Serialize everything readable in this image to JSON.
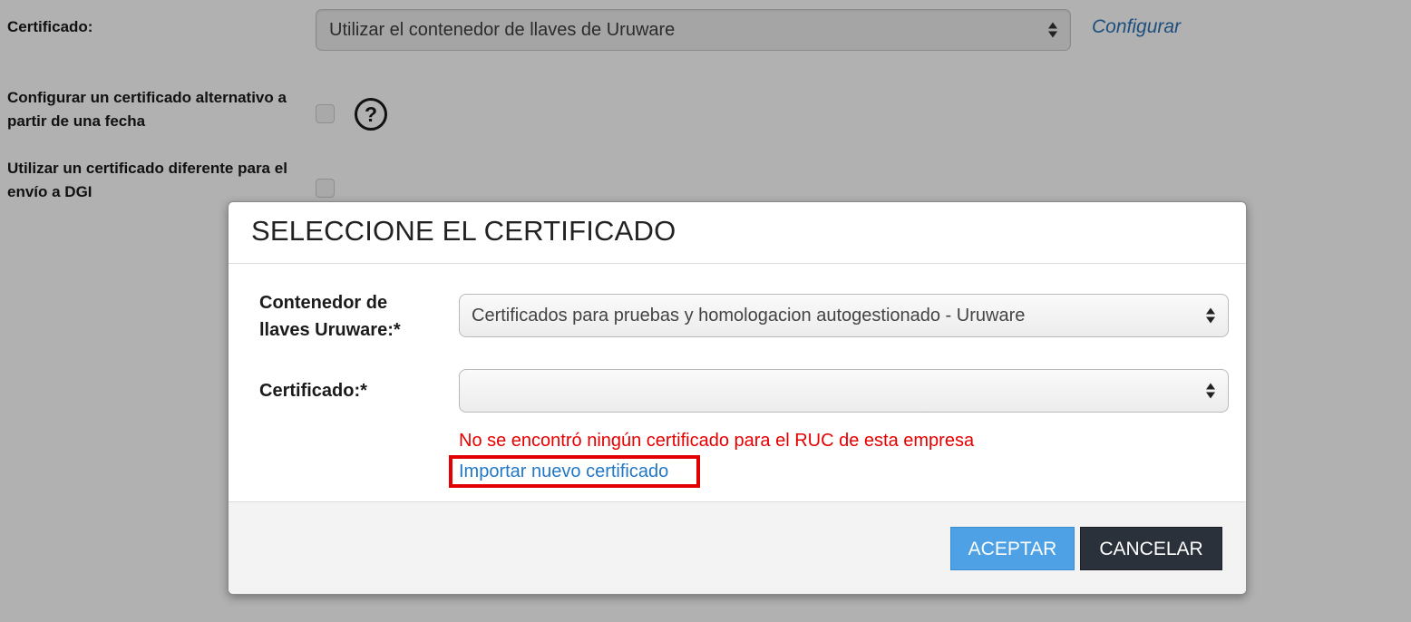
{
  "background": {
    "certificate_label": "Certificado:",
    "certificate_select_value": "Utilizar el contenedor de llaves de Uruware",
    "configure_link": "Configurar",
    "alt_cert_label_line1": "Configurar un certificado alternativo  a",
    "alt_cert_label_line2": "partir de una fecha",
    "help_icon_glyph": "?",
    "diff_cert_label_line1": "Utilizar un certificado diferente para el",
    "diff_cert_label_line2": "envío a DGI"
  },
  "modal": {
    "title": "SELECCIONE EL CERTIFICADO",
    "container_label_line1": "Contenedor de",
    "container_label_line2": "llaves Uruware:*",
    "container_select_value": "Certificados para pruebas y homologacion autogestionado - Uruware",
    "certificate_label": "Certificado:*",
    "certificate_select_value": "",
    "error_message": "No se encontró ningún certificado para el RUC de esta empresa",
    "import_link": "Importar nuevo certificado",
    "accept_button": "ACEPTAR",
    "cancel_button": "CANCELAR"
  },
  "colors": {
    "overlay_background": "#b1b1b1",
    "error_text": "#e60000",
    "link": "#2378c6",
    "highlight_box": "#e30000",
    "accept_button": "#4ea1e4",
    "cancel_button": "#2a313b"
  },
  "icons": {
    "select_arrows": "updown-arrows-icon",
    "help": "question-circle-icon"
  }
}
